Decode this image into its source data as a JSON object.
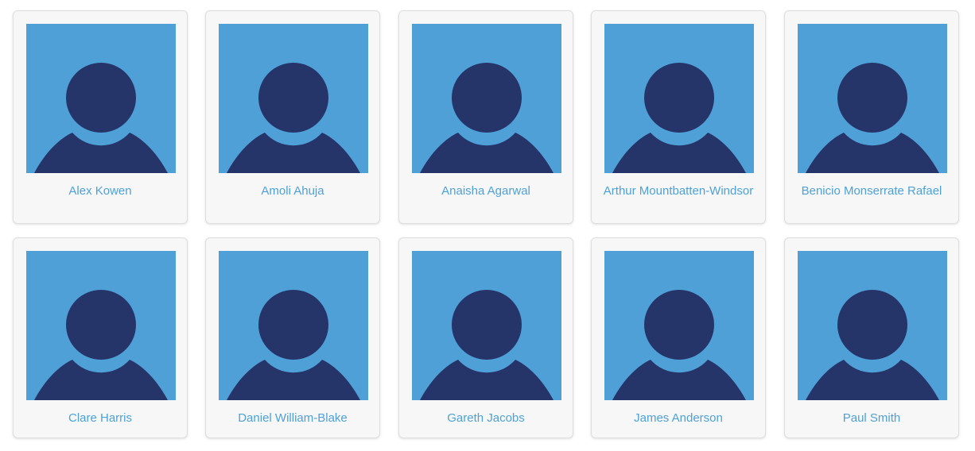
{
  "colors": {
    "avatar_background": "#50a0d8",
    "avatar_silhouette": "#25356a",
    "name_link": "#4ea1d8",
    "card_background": "#f7f7f7"
  },
  "avatar_icon": "user-silhouette-icon",
  "people": [
    {
      "name": "Alex Kowen"
    },
    {
      "name": "Amoli Ahuja"
    },
    {
      "name": "Anaisha Agarwal"
    },
    {
      "name": "Arthur Mountbatten-Windsor"
    },
    {
      "name": "Benicio Monserrate Rafael"
    },
    {
      "name": "Clare Harris"
    },
    {
      "name": "Daniel William-Blake"
    },
    {
      "name": "Gareth Jacobs"
    },
    {
      "name": "James Anderson"
    },
    {
      "name": "Paul Smith"
    }
  ]
}
